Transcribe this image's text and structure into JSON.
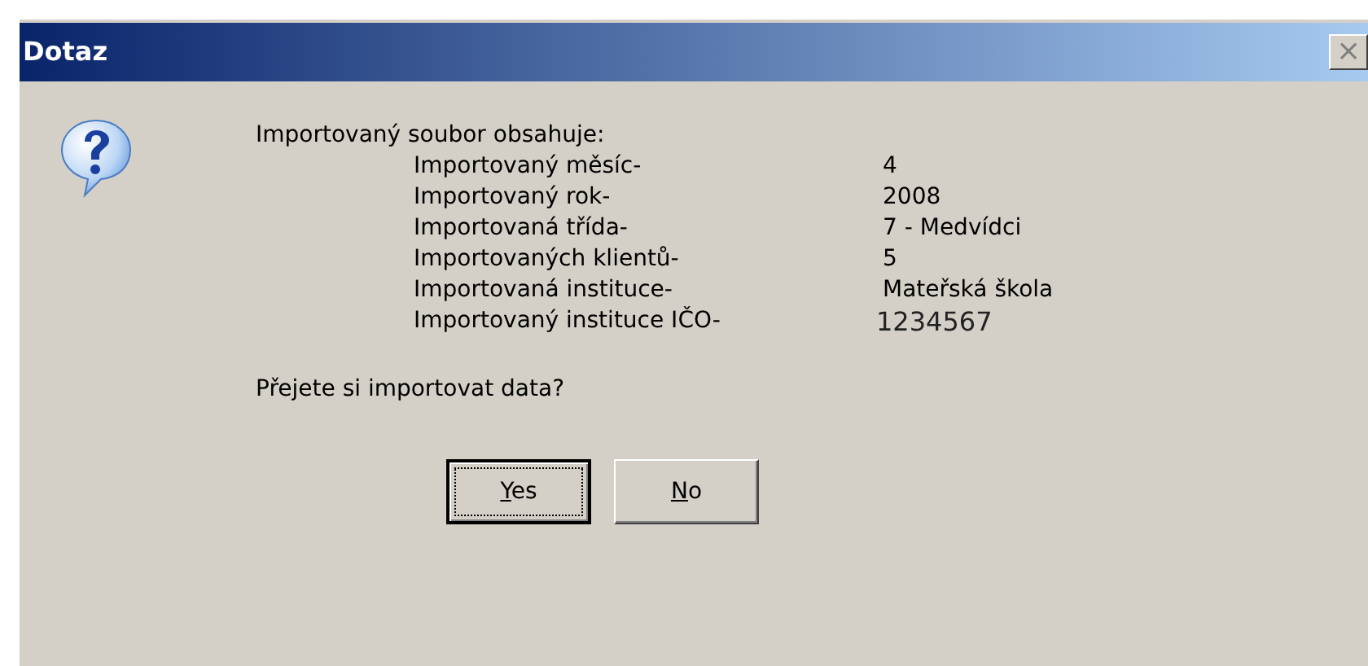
{
  "window": {
    "title": "Dotaz",
    "close": "×"
  },
  "message": {
    "intro": "Importovaný soubor obsahuje:",
    "rows": [
      {
        "label": "Importovaný měsíc-",
        "value": "4",
        "kind": "plain"
      },
      {
        "label": "Importovaný rok-",
        "value": "2008",
        "kind": "plain"
      },
      {
        "label": "Importovaná třída-",
        "value": "7 - Medvídci",
        "kind": "plain"
      },
      {
        "label": "Importovaných klientů-",
        "value": "5",
        "kind": "plain"
      },
      {
        "label": "Importovaná instituce-",
        "value": "Mateřská škola",
        "kind": "plain"
      },
      {
        "label": "Importovaný instituce IČO-",
        "value": "1234567",
        "kind": "large"
      }
    ],
    "question": "Přejete si importovat data?"
  },
  "buttons": [
    {
      "mnemonic": "Y",
      "rest": "es",
      "default": true
    },
    {
      "mnemonic": "N",
      "rest": "o",
      "default": false
    }
  ]
}
